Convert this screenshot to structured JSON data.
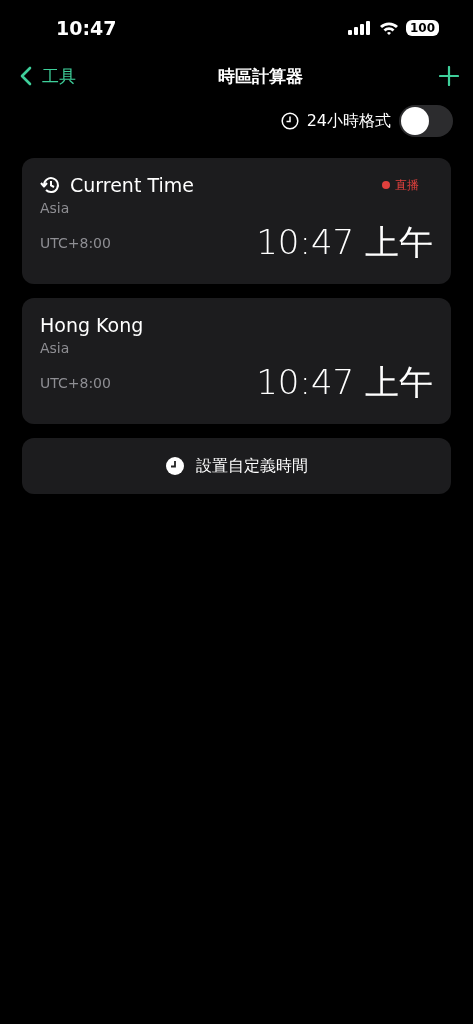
{
  "status_bar": {
    "time": "10:47",
    "battery": "100"
  },
  "nav": {
    "back_label": "工具",
    "title": "時區計算器"
  },
  "format_toggle": {
    "label": "24小時格式",
    "on": false
  },
  "cards": [
    {
      "kind": "current",
      "name": "Current Time",
      "region": "Asia",
      "offset": "UTC+8:00",
      "time": "10:47 上午",
      "badge": "直播"
    },
    {
      "kind": "zone",
      "name": "Hong Kong",
      "region": "Asia",
      "offset": "UTC+8:00",
      "time": "10:47 上午"
    }
  ],
  "custom_button": {
    "label": "設置自定義時間"
  }
}
